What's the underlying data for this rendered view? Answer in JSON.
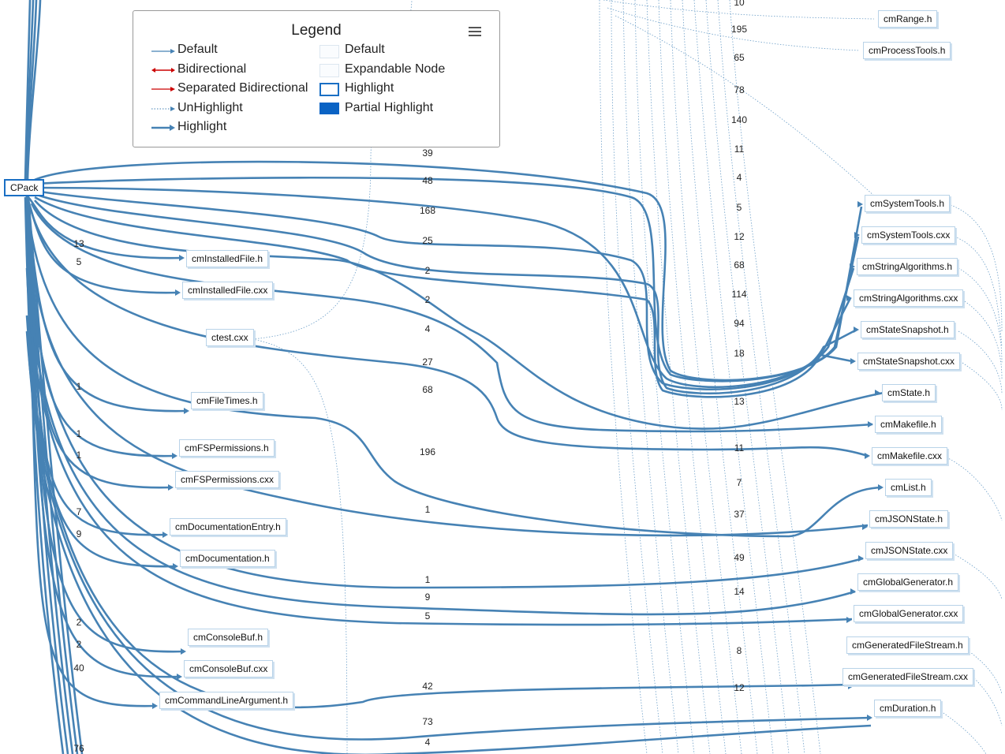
{
  "legend": {
    "title": "Legend",
    "edges": [
      "Default",
      "Bidirectional",
      "Separated Bidirectional",
      "UnHighlight",
      "Highlight"
    ],
    "nodes": [
      "Default",
      "Expandable Node",
      "Highlight",
      "Partial Highlight"
    ],
    "colors": {
      "edge": "#4682b4",
      "bidirectional": "#cc0000",
      "highlight_fill": "#0b63c4",
      "node_border": "#b9d3e8"
    }
  },
  "root": "CPack",
  "left_nodes": [
    "cmInstalledFile.h",
    "cmInstalledFile.cxx",
    "ctest.cxx",
    "cmFileTimes.h",
    "cmFSPermissions.h",
    "cmFSPermissions.cxx",
    "cmDocumentationEntry.h",
    "cmDocumentation.h",
    "cmConsoleBuf.h",
    "cmConsoleBuf.cxx",
    "cmCommandLineArgument.h"
  ],
  "right_nodes": [
    "cmRange.h",
    "cmProcessTools.h",
    "cmSystemTools.h",
    "cmSystemTools.cxx",
    "cmStringAlgorithms.h",
    "cmStringAlgorithms.cxx",
    "cmStateSnapshot.h",
    "cmStateSnapshot.cxx",
    "cmState.h",
    "cmMakefile.h",
    "cmMakefile.cxx",
    "cmList.h",
    "cmJSONState.h",
    "cmJSONState.cxx",
    "cmGlobalGenerator.h",
    "cmGlobalGenerator.cxx",
    "cmGeneratedFileStream.h",
    "cmGeneratedFileStream.cxx",
    "cmDuration.h"
  ],
  "left_labels": [
    "13",
    "5",
    "1",
    "1",
    "1",
    "7",
    "9",
    "2",
    "2",
    "40",
    "76"
  ],
  "mid_labels": [
    "39",
    "48",
    "168",
    "25",
    "2",
    "2",
    "4",
    "27",
    "68",
    "196",
    "1",
    "1",
    "9",
    "5",
    "42",
    "73",
    "4"
  ],
  "right_labels": [
    "10",
    "195",
    "65",
    "78",
    "140",
    "11",
    "4",
    "5",
    "12",
    "68",
    "114",
    "94",
    "18",
    "13",
    "11",
    "7",
    "37",
    "49",
    "14",
    "8",
    "12"
  ]
}
